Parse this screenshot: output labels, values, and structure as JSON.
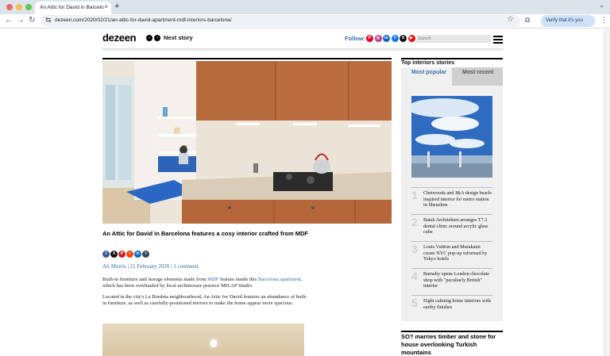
{
  "browser": {
    "tab_title": "An Attic for David in Barcelo",
    "url": "dezeen.com/2020/02/21/an-attic-for-david-apartment-mdf-interiors-barcelona/",
    "verify_label": "Verify that it's you",
    "new_tab": "+",
    "tab_close": "×",
    "back": "←",
    "forward": "→",
    "reload": "↻",
    "menu": "⋮",
    "chevron": "⌄",
    "star": "☆",
    "site_settings": "⇆",
    "extensions": "⧉",
    "colors": {
      "close": "#ed6a5e",
      "minimize": "#f5bf4f",
      "maximize": "#62c554"
    }
  },
  "header": {
    "logo": "dezeen",
    "prev_arrow": "‹",
    "next_arrow": "›",
    "next_story": "Next story",
    "follow_label": "Follow:",
    "social_icons": [
      {
        "name": "pinterest",
        "glyph": "P",
        "color": "#e60023"
      },
      {
        "name": "instagram",
        "glyph": "◎",
        "color": "#c13584"
      },
      {
        "name": "linkedin",
        "glyph": "in",
        "color": "#0a66c2"
      },
      {
        "name": "facebook",
        "glyph": "f",
        "color": "#1877f2"
      },
      {
        "name": "x",
        "glyph": "X",
        "color": "#111111"
      },
      {
        "name": "youtube",
        "glyph": "▶",
        "color": "#ff0000"
      }
    ],
    "search_placeholder": "Search"
  },
  "article": {
    "headline": "An Attic for David in Barcelona features a cosy interior crafted from MDF",
    "share_icons": [
      {
        "name": "facebook",
        "glyph": "f",
        "color": "#3b5998"
      },
      {
        "name": "x",
        "glyph": "X",
        "color": "#111111"
      },
      {
        "name": "pinterest",
        "glyph": "P",
        "color": "#cb2027"
      },
      {
        "name": "reddit",
        "glyph": "r",
        "color": "#ff4500"
      },
      {
        "name": "linkedin",
        "glyph": "in",
        "color": "#0a66c2"
      },
      {
        "name": "tumblr",
        "glyph": "t",
        "color": "#35465c"
      }
    ],
    "author": "Ali Morris",
    "date": "21 February 2020",
    "comments": "1 comment",
    "para1_a": "Built-in furniture and storage elements made from ",
    "para1_link1": "MDF",
    "para1_b": " feature inside this ",
    "para1_link2": "Barcelona apartment",
    "para1_c": ", which has been overhauled by local architecture practice MH.AP Studio.",
    "para2": "Located in the city's La Bordeta neighbourhood, An Attic for David features an abundance of built-in furniture, as well as carefully-positioned mirrors to make the home appear more spacious."
  },
  "sidebar": {
    "title": "Top interiors stories",
    "tab_popular": "Most popular",
    "tab_recent": "Most recent",
    "stories": [
      {
        "num": "1",
        "text": "Chetwoods and J&A design beach-inspired interior for metro station in Shenzhen"
      },
      {
        "num": "2",
        "text": "Batek Architekten arranges T7.2 dental clinic around acrylic glass cube"
      },
      {
        "num": "3",
        "text": "Louis Vuitton and Murakami create NYC pop-up informed by Tokyo hotels"
      },
      {
        "num": "4",
        "text": "Barnaby opens London chocolate shop with \"peculiarly British\" interior"
      },
      {
        "num": "5",
        "text": "Eight calming home interiors with earthy finishes"
      }
    ],
    "next_headline": "SO? marries timber and stone for house overlooking Turkish mountains"
  }
}
